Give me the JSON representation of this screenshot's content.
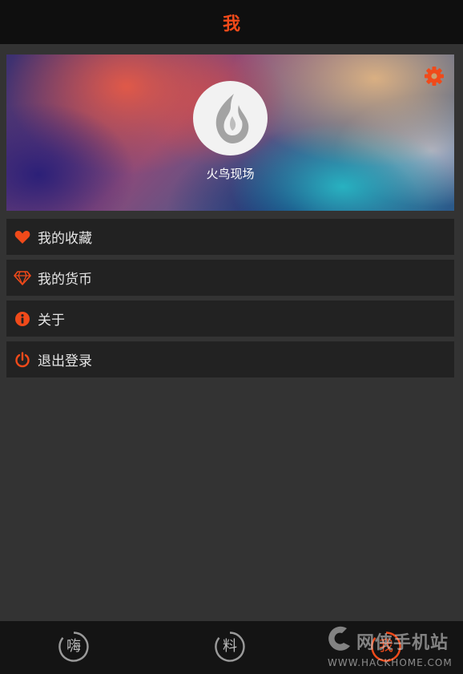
{
  "header": {
    "title": "我"
  },
  "profile": {
    "username": "火鸟现场"
  },
  "menu": [
    {
      "label": "我的收藏",
      "icon": "heart-icon"
    },
    {
      "label": "我的货币",
      "icon": "diamond-icon"
    },
    {
      "label": "关于",
      "icon": "info-icon"
    },
    {
      "label": "退出登录",
      "icon": "power-icon"
    }
  ],
  "tabs": [
    {
      "label": "嗨",
      "active": false
    },
    {
      "label": "料",
      "active": false
    },
    {
      "label": "我",
      "active": true
    }
  ],
  "watermark": {
    "title": "网侠手机站",
    "url": "WWW.HACKHOME.COM"
  },
  "colors": {
    "accent": "#f04a1a",
    "background": "#333333",
    "item": "#222222",
    "header": "#0f0f0f"
  }
}
